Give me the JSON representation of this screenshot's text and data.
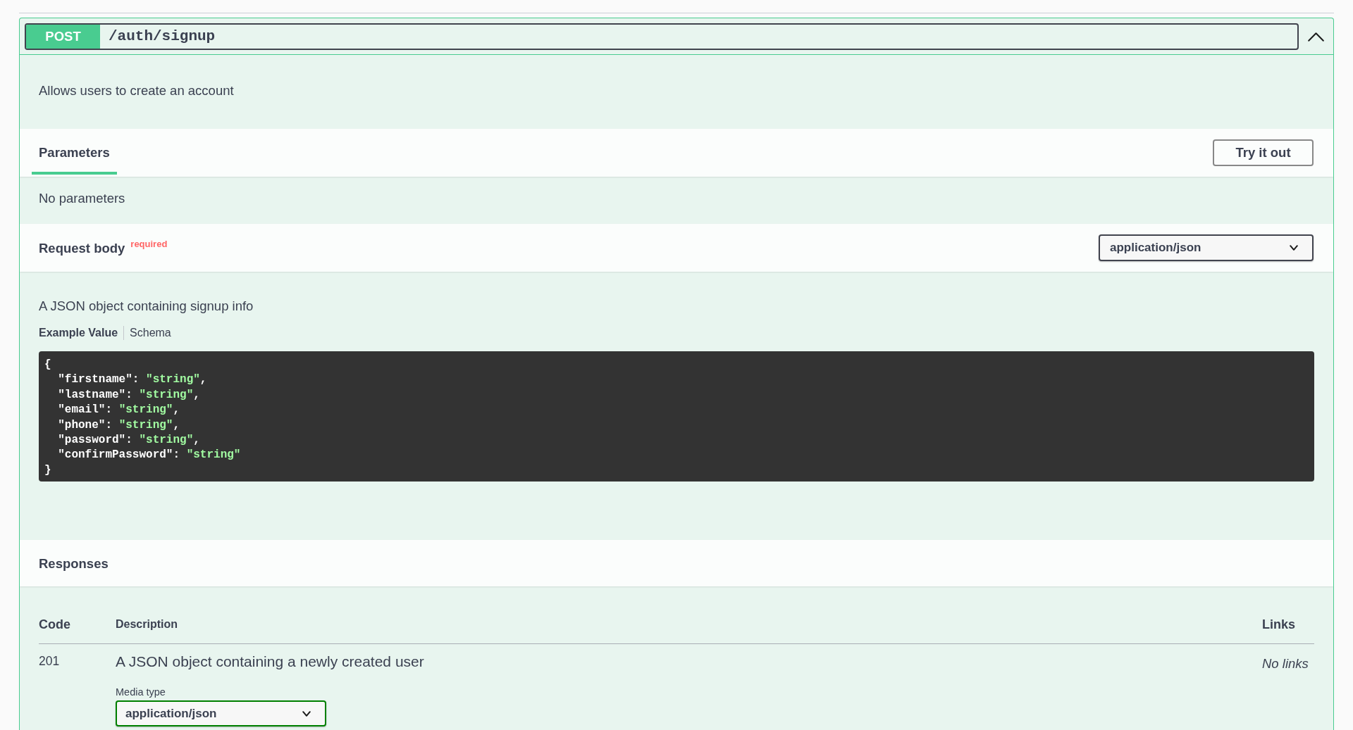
{
  "operation": {
    "method": "POST",
    "path": "/auth/signup",
    "expanded": true,
    "description": "Allows users to create an account"
  },
  "parameters": {
    "tabs": [
      {
        "label": "Parameters",
        "selected": true
      }
    ],
    "try_button": "Try it out",
    "empty_text": "No parameters"
  },
  "request_body": {
    "title": "Request body",
    "required_label": "required",
    "content_type": "application/json",
    "description": "A JSON object containing signup info",
    "tabs": [
      {
        "label": "Example Value",
        "selected": true
      },
      {
        "label": "Schema",
        "selected": false
      }
    ],
    "example_lines": [
      [
        {
          "kind": "plain",
          "text": "{"
        }
      ],
      [
        {
          "kind": "plain",
          "text": "  \"firstname\": "
        },
        {
          "kind": "string",
          "text": "\"string\""
        },
        {
          "kind": "plain",
          "text": ","
        }
      ],
      [
        {
          "kind": "plain",
          "text": "  \"lastname\": "
        },
        {
          "kind": "string",
          "text": "\"string\""
        },
        {
          "kind": "plain",
          "text": ","
        }
      ],
      [
        {
          "kind": "plain",
          "text": "  \"email\": "
        },
        {
          "kind": "string",
          "text": "\"string\""
        },
        {
          "kind": "plain",
          "text": ","
        }
      ],
      [
        {
          "kind": "plain",
          "text": "  \"phone\": "
        },
        {
          "kind": "string",
          "text": "\"string\""
        },
        {
          "kind": "plain",
          "text": ","
        }
      ],
      [
        {
          "kind": "plain",
          "text": "  \"password\": "
        },
        {
          "kind": "string",
          "text": "\"string\""
        },
        {
          "kind": "plain",
          "text": ","
        }
      ],
      [
        {
          "kind": "plain",
          "text": "  \"confirmPassword\": "
        },
        {
          "kind": "string",
          "text": "\"string\""
        }
      ],
      [
        {
          "kind": "plain",
          "text": "}"
        }
      ]
    ]
  },
  "responses": {
    "title": "Responses",
    "columns": [
      "Code",
      "Description",
      "Links"
    ],
    "rows": [
      {
        "code": "201",
        "description": "A JSON object containing a newly created user",
        "media_type_label": "Media type",
        "media_type": "application/json",
        "links": "No links"
      }
    ]
  }
}
